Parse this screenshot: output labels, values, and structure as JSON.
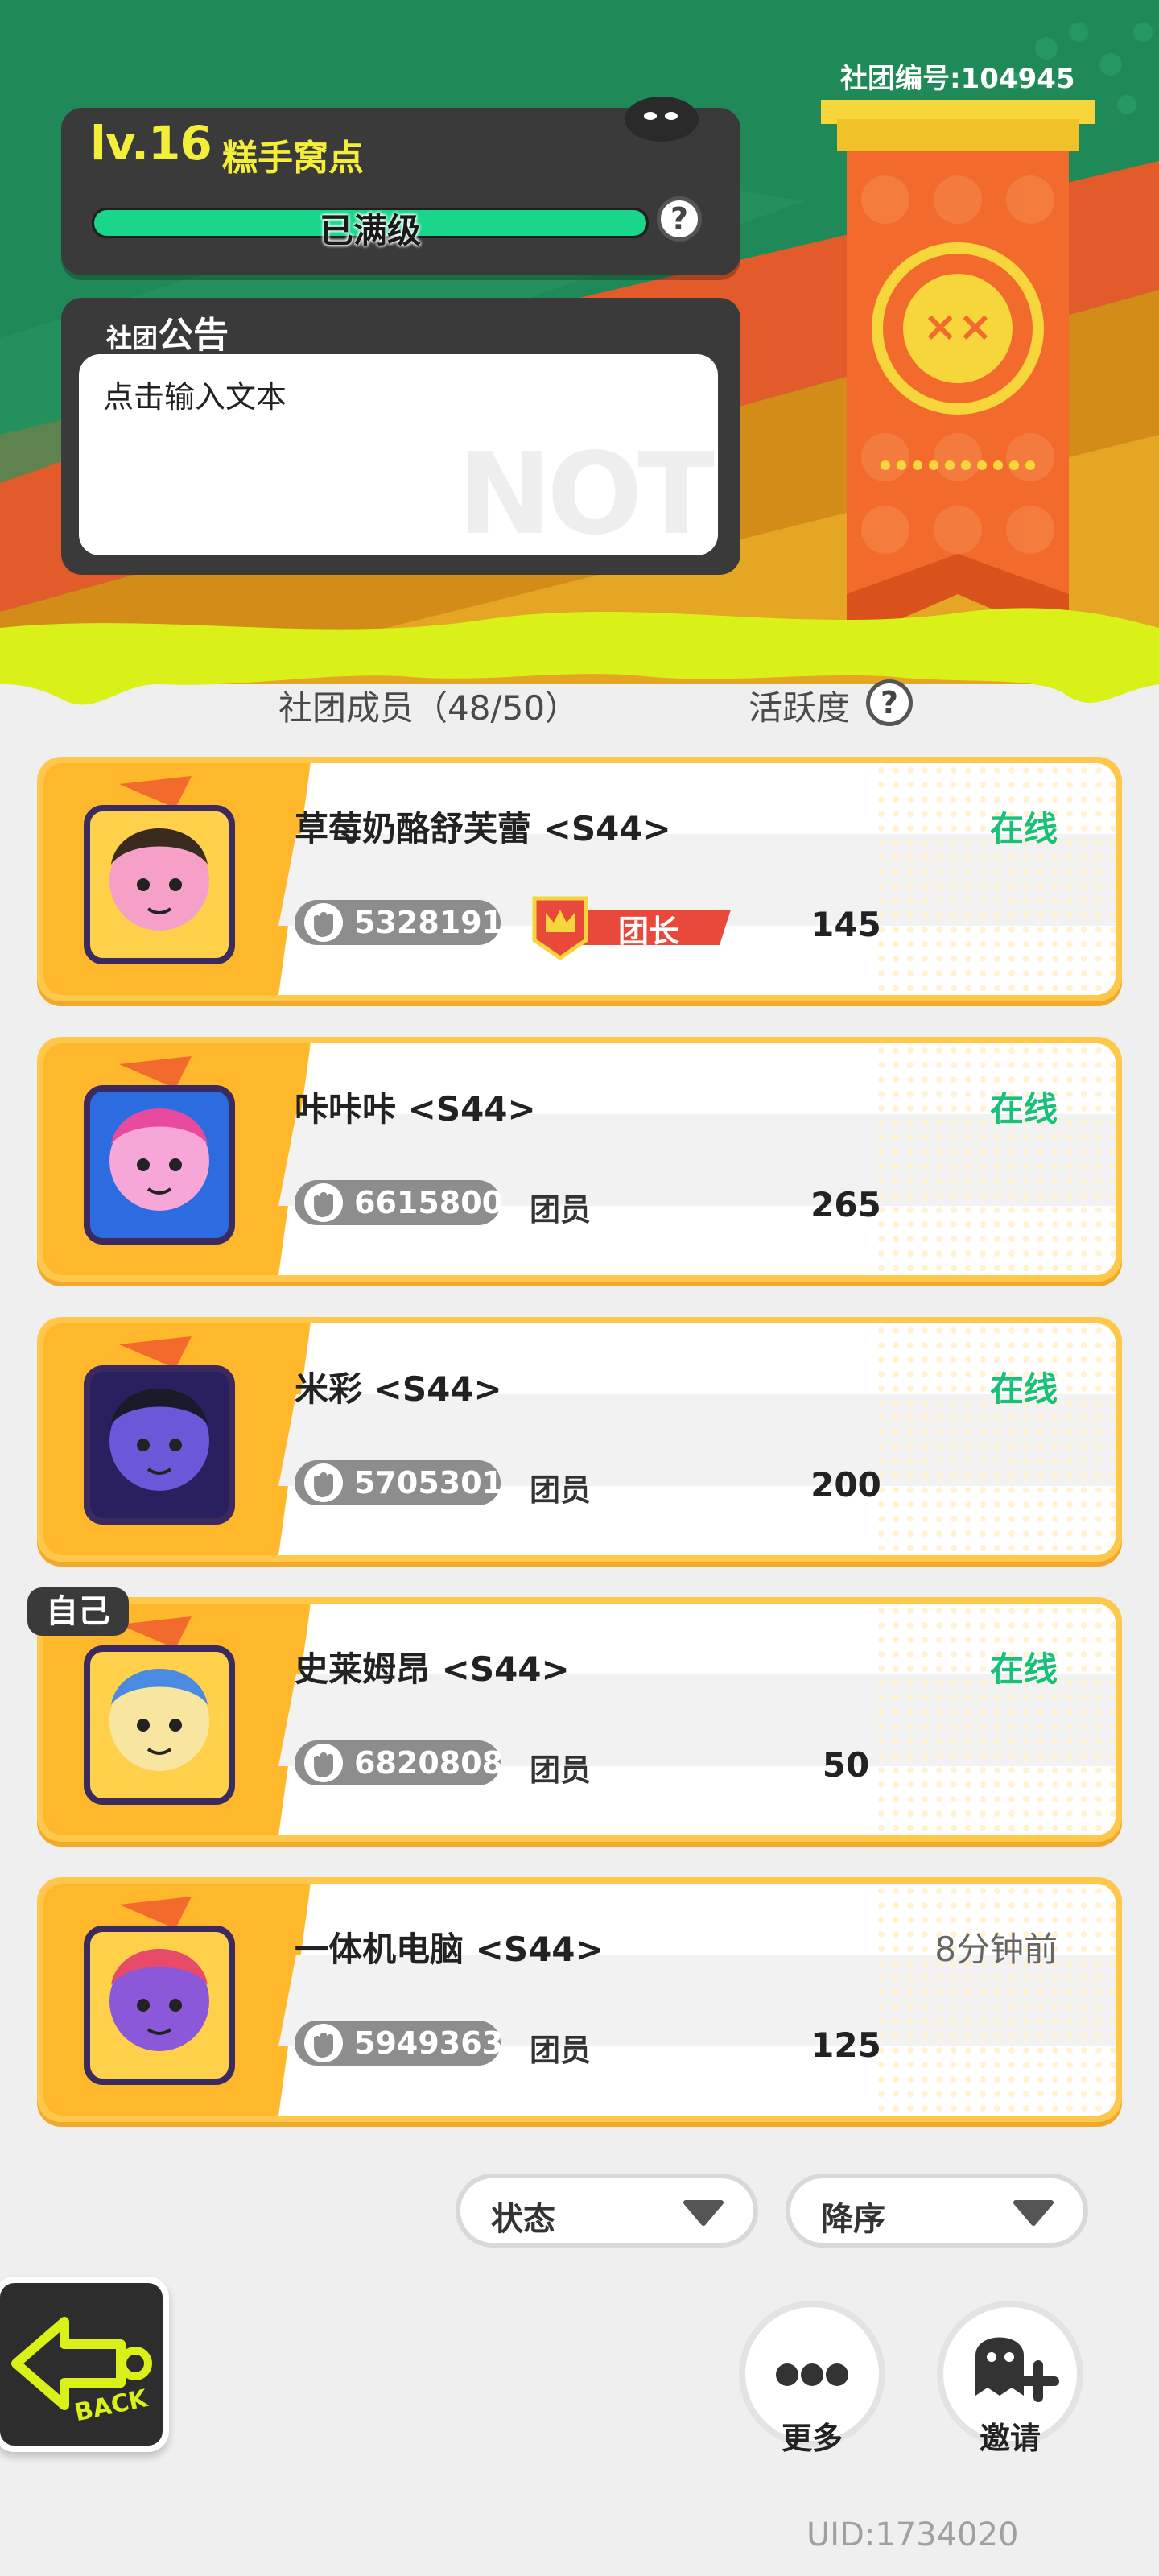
{
  "club": {
    "level_label": "lv.16",
    "name": "糕手窝点",
    "progress_text": "已满级",
    "progress_fraction": 1.0,
    "id_label": "社团编号:104945"
  },
  "notice": {
    "title_small": "社团",
    "title_big": "公告",
    "placeholder_text": "点击输入文本",
    "watermark": "NOT"
  },
  "list_header": {
    "members": "社团成员（48/50）",
    "activity": "活跃度"
  },
  "members": [
    {
      "name": "草莓奶酪舒芙蕾 <S44>",
      "status": "在线",
      "power": "5328191",
      "role": "团长",
      "activity": "145",
      "is_self": false
    },
    {
      "name": "咔咔咔 <S44>",
      "status": "在线",
      "power": "6615800",
      "role": "团员",
      "activity": "265",
      "is_self": false
    },
    {
      "name": "米彩 <S44>",
      "status": "在线",
      "power": "5705301",
      "role": "团员",
      "activity": "200",
      "is_self": false
    },
    {
      "name": "史莱姆昂 <S44>",
      "status": "在线",
      "power": "6820808",
      "role": "团员",
      "activity": "50",
      "is_self": true
    },
    {
      "name": "一体机电脑 <S44>",
      "status": "8分钟前",
      "power": "5949363",
      "role": "团员",
      "activity": "125",
      "is_self": false
    }
  ],
  "self_tag": "自己",
  "filters": {
    "status_label": "状态",
    "order_label": "降序"
  },
  "actions": {
    "back_label": "BACK",
    "more_label": "更多",
    "invite_label": "邀请"
  },
  "uid": "UID:1734020",
  "colors": {
    "accent_green": "#19d68b",
    "online_green": "#19c07a",
    "card_yellow": "#ffc84a",
    "banner_orange": "#f26a2c",
    "slime_yellow": "#d9f019"
  }
}
